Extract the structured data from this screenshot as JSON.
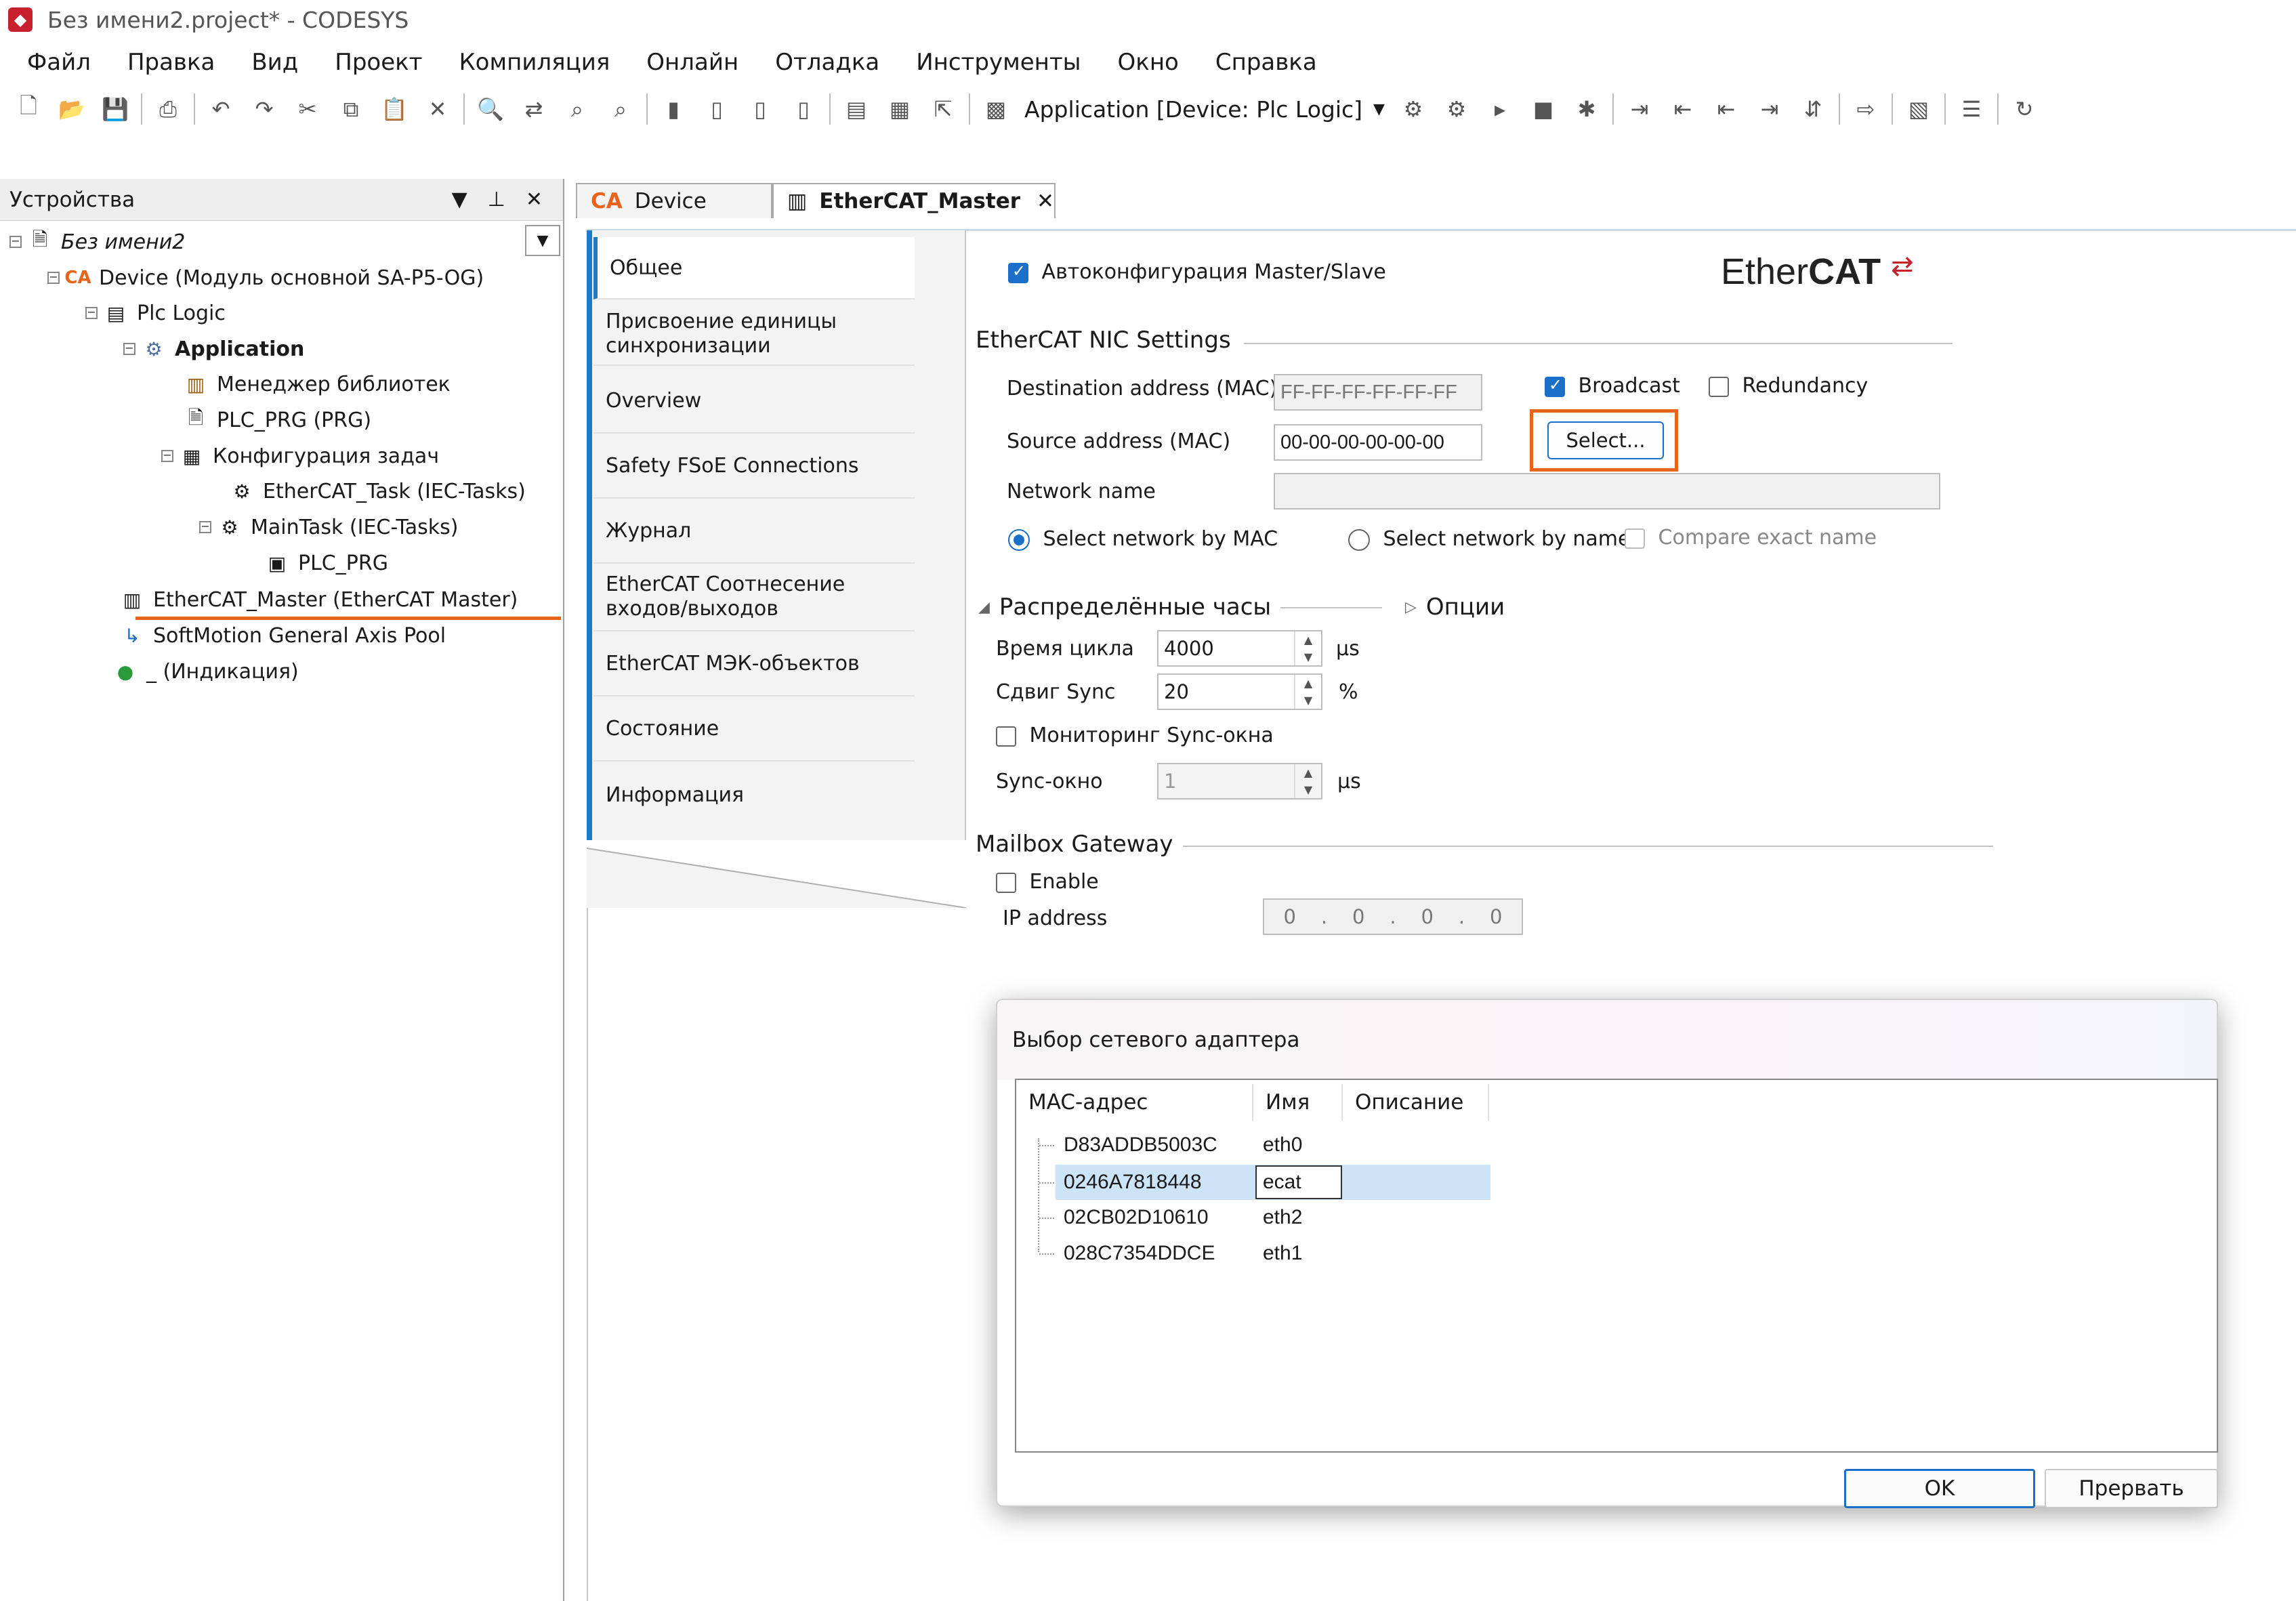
{
  "window": {
    "title": "Без имени2.project* - CODESYS"
  },
  "menu": [
    "Файл",
    "Правка",
    "Вид",
    "Проект",
    "Компиляция",
    "Онлайн",
    "Отладка",
    "Инструменты",
    "Окно",
    "Справка"
  ],
  "toolbar": {
    "app_selector": "Application [Device: Plc Logic]"
  },
  "devices_panel": {
    "title": "Устройства",
    "tree": [
      {
        "label": "Без имени2",
        "icon": "project-icon"
      },
      {
        "label": "Device (Модуль основной SA-P5-OG)",
        "icon": "device-icon"
      },
      {
        "label": "Plc Logic",
        "icon": "plc-logic-icon"
      },
      {
        "label": "Application",
        "icon": "application-gear-icon"
      },
      {
        "label": "Менеджер библиотек",
        "icon": "library-icon"
      },
      {
        "label": "PLC_PRG (PRG)",
        "icon": "program-icon"
      },
      {
        "label": "Конфигурация задач",
        "icon": "task-config-icon"
      },
      {
        "label": "EtherCAT_Task (IEC-Tasks)",
        "icon": "task-icon"
      },
      {
        "label": "MainTask (IEC-Tasks)",
        "icon": "task-icon"
      },
      {
        "label": "PLC_PRG",
        "icon": "program-call-icon"
      },
      {
        "label": "EtherCAT_Master (EtherCAT Master)",
        "icon": "ethercat-master-icon"
      },
      {
        "label": "SoftMotion General Axis Pool",
        "icon": "axis-pool-icon"
      },
      {
        "label": "_ (Индикация)",
        "icon": "indicator-icon"
      }
    ]
  },
  "tabs": [
    {
      "label": "Device"
    },
    {
      "label": "EtherCAT_Master"
    }
  ],
  "sidenav": [
    "Общее",
    "Присвоение единицы синхронизации",
    "Overview",
    "Safety FSoE Connections",
    "Журнал",
    "EtherCAT Соотнесение входов/выходов",
    "EtherCAT МЭК-объектов",
    "Состояние",
    "Информация"
  ],
  "general": {
    "autoconfig_label": "Автоконфигурация Master/Slave",
    "autoconfig_checked": true,
    "logo_text_plain": "Ether",
    "logo_text_bold": "CAT",
    "nic_section": "EtherCAT NIC Settings",
    "dest_label": "Destination address (MAC)",
    "dest_value": "FF-FF-FF-FF-FF-FF",
    "broadcast_label": "Broadcast",
    "broadcast_checked": true,
    "redundancy_label": "Redundancy",
    "redundancy_checked": false,
    "source_label": "Source address (MAC)",
    "source_value": "00-00-00-00-00-00",
    "select_button": "Select...",
    "network_name_label": "Network name",
    "network_name_value": "",
    "radio_mac": "Select network by MAC",
    "radio_name": "Select network by name",
    "compare_exact": "Compare exact name",
    "dc_section": "Распределённые часы",
    "options_section": "Опции",
    "cycle_label": "Время цикла",
    "cycle_value": "4000",
    "cycle_unit": "µs",
    "sync_shift_label": "Сдвиг Sync",
    "sync_shift_value": "20",
    "sync_shift_unit": "%",
    "sync_monitor_label": "Мониторинг Sync-окна",
    "sync_window_label": "Sync-окно",
    "sync_window_value": "1",
    "sync_window_unit": "µs",
    "mailbox_section": "Mailbox Gateway",
    "enable_label": "Enable",
    "ip_label": "IP address",
    "ip_parts": [
      "0",
      "0",
      "0",
      "0"
    ]
  },
  "dialog": {
    "title": "Выбор сетевого адаптера",
    "columns": [
      "MAC-адрес",
      "Имя",
      "Описание"
    ],
    "rows": [
      {
        "mac": "D83ADDB5003C",
        "name": "eth0",
        "desc": ""
      },
      {
        "mac": "0246A7818448",
        "name": "ecat",
        "desc": ""
      },
      {
        "mac": "02CB02D10610",
        "name": "eth2",
        "desc": ""
      },
      {
        "mac": "028C7354DDCE",
        "name": "eth1",
        "desc": ""
      }
    ],
    "selected_row": 1,
    "ok": "OK",
    "cancel": "Прервать"
  },
  "colors": {
    "accent": "#1a6fc9",
    "highlight": "#e8641b",
    "selection": "#cde3f7"
  }
}
